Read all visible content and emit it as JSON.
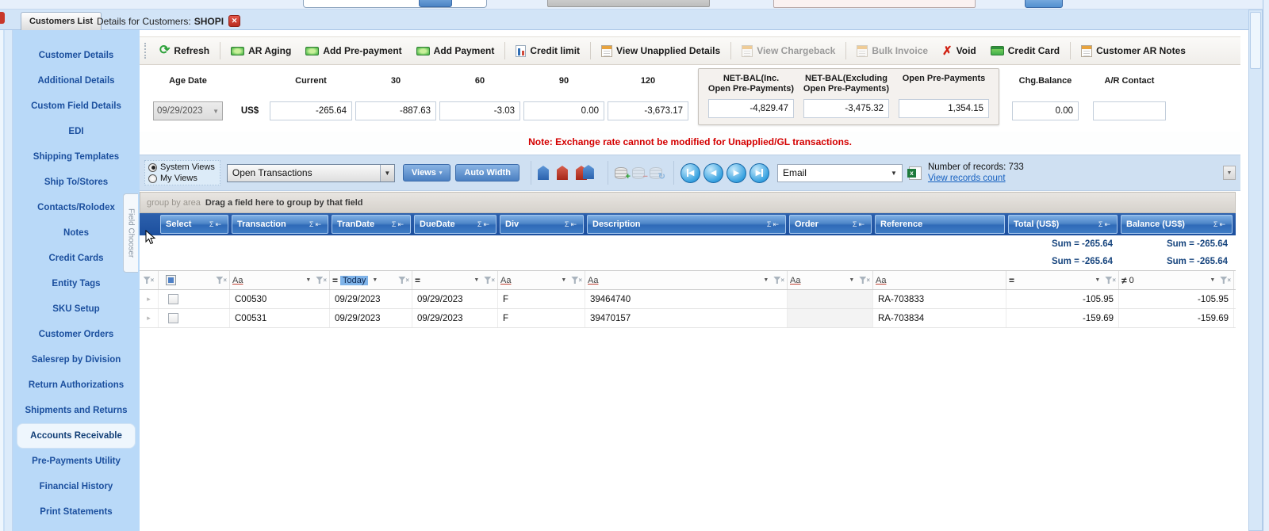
{
  "icons": {
    "refresh": "⟳",
    "void": "✗",
    "sum": "Σ",
    "pin": "⇤",
    "dropdown": "▼",
    "filter_x": "×",
    "aa": "Aa",
    "equals": "=",
    "nav_prev": "◀",
    "nav_next": "▶",
    "row_arrow": "▸",
    "excel_x": "x",
    "db_add": "+",
    "db_remove": "−",
    "db_refresh": "↻",
    "close_x": "✕",
    "views_arrow": "▾"
  },
  "tabs": {
    "customers_list": "Customers List",
    "details_prefix": "Details for Customers:",
    "details_code": "SHOPI"
  },
  "sidebar": {
    "items": [
      "Customer Details",
      "Additional Details",
      "Custom Field Details",
      "EDI",
      "Shipping Templates",
      "Ship To/Stores",
      "Contacts/Rolodex",
      "Notes",
      "Credit Cards",
      "Entity Tags",
      "SKU Setup",
      "Customer Orders",
      "Salesrep by Division",
      "Return Authorizations",
      "Shipments and Returns",
      "Accounts Receivable",
      "Pre-Payments Utility",
      "Financial History",
      "Print Statements"
    ]
  },
  "toolbar": {
    "buttons": [
      {
        "label": "Refresh"
      },
      {
        "label": "AR Aging"
      },
      {
        "label": "Add Pre-payment"
      },
      {
        "label": "Add Payment"
      },
      {
        "label": "Credit limit"
      },
      {
        "label": "View Unapplied Details"
      },
      {
        "label": "View Chargeback"
      },
      {
        "label": "Bulk Invoice"
      },
      {
        "label": "Void"
      },
      {
        "label": "Credit Card"
      },
      {
        "label": "Customer AR Notes"
      }
    ]
  },
  "aging": {
    "age_date_label": "Age Date",
    "age_date_value": "09/29/2023",
    "currency": "US$",
    "buckets": [
      {
        "label": "Current",
        "value": "-265.64"
      },
      {
        "label": "30",
        "value": "-887.63"
      },
      {
        "label": "60",
        "value": "-3.03"
      },
      {
        "label": "90",
        "value": "0.00"
      },
      {
        "label": "120",
        "value": "-3,673.17"
      }
    ],
    "netbal": [
      {
        "label1": "NET-BAL(Inc.",
        "label2": "Open Pre-Payments)",
        "value": "-4,829.47"
      },
      {
        "label1": "NET-BAL(Excluding",
        "label2": "Open Pre-Payments)",
        "value": "-3,475.32"
      },
      {
        "label1": "Open Pre-Payments",
        "label2": "",
        "value": "1,354.15"
      }
    ],
    "chg_label": "Chg.Balance",
    "chg_value": "0.00",
    "contact_label": "A/R Contact",
    "contact_value": ""
  },
  "note": "Note: Exchange rate cannot be modified for Unapplied/GL transactions.",
  "viewbar": {
    "system_views": "System Views",
    "my_views": "My Views",
    "view_name": "Open Transactions",
    "views_btn": "Views",
    "autowidth_btn": "Auto Width",
    "email": "Email",
    "records": "Number of records: 733",
    "records_link": "View records count"
  },
  "grid": {
    "field_chooser": "Field Chooser",
    "groupby_prefix": "group by area",
    "groupby_text": "Drag a field here to group by that field",
    "columns": [
      "Select",
      "Transaction",
      "TranDate",
      "DueDate",
      "Div",
      "Description",
      "Order",
      "Reference",
      "Total (US$)",
      "Balance (US$)"
    ],
    "sums": {
      "total1": "Sum = -265.64",
      "balance1": "Sum = -265.64",
      "total2": "Sum = -265.64",
      "balance2": "Sum = -265.64"
    },
    "filter": {
      "trandate": "Today",
      "balance_op": "≠",
      "balance_val": "0"
    },
    "rows": [
      {
        "transaction": "C00530",
        "trandate": "09/29/2023",
        "duedate": "09/29/2023",
        "div": "F",
        "description": "39464740",
        "order": "",
        "reference": "RA-703833",
        "total": "-105.95",
        "balance": "-105.95"
      },
      {
        "transaction": "C00531",
        "trandate": "09/29/2023",
        "duedate": "09/29/2023",
        "div": "F",
        "description": "39470157",
        "order": "",
        "reference": "RA-703834",
        "total": "-159.69",
        "balance": "-159.69"
      }
    ]
  },
  "colors": {
    "accent_blue": "#2e6db4",
    "note_red": "#d40000",
    "link_blue": "#1560c0"
  }
}
